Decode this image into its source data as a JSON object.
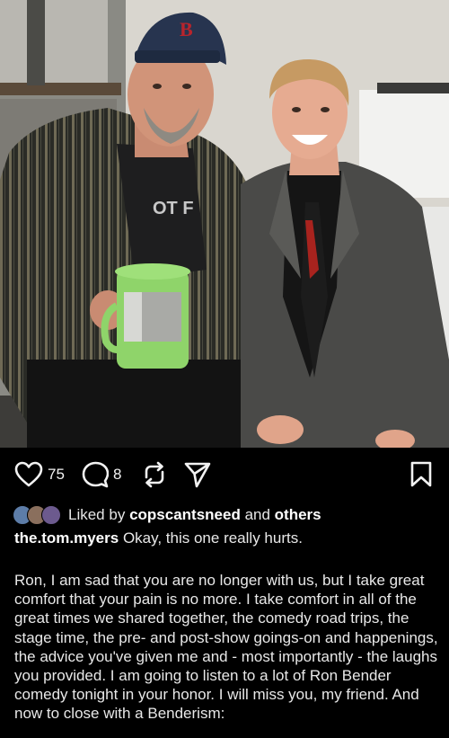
{
  "post": {
    "likes": "75",
    "comments": "8",
    "liked_by_prefix": "Liked by",
    "liked_by_user": "copscantsneed",
    "liked_by_and": "and",
    "liked_by_others": "others",
    "author": "the.tom.myers",
    "caption_first": "Okay, this one really hurts.",
    "caption_body": "Ron, I am sad that you are no longer with us, but I take great comfort that your pain is no more. I take comfort in all of the great times we shared together, the comedy road trips, the stage time, the pre- and post-show goings-on and happenings, the advice you've given me and - most importantly - the laughs you provided. I am going to listen to a lot of Ron Bender comedy tonight in your honor. I will miss you, my friend. And now to close with a Benderism:"
  },
  "icons": {
    "like": "heart-icon",
    "comment": "comment-bubble-icon",
    "share": "repost-icon",
    "send": "send-icon",
    "save": "bookmark-icon"
  },
  "photo": {
    "cap_logo": "B",
    "shirt_text": "OT F"
  }
}
